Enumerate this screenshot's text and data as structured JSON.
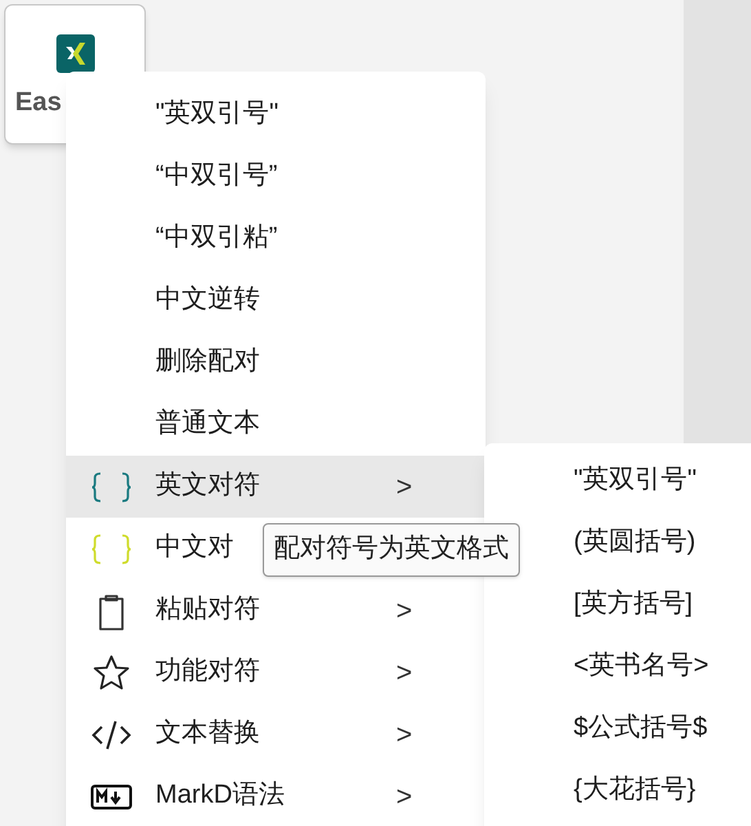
{
  "app_tile": {
    "label": "Eas"
  },
  "context_menu": {
    "items": [
      {
        "label": "\"英双引号\"",
        "kind": "plain",
        "selected": false
      },
      {
        "label": "“中双引号”",
        "kind": "plain",
        "selected": false
      },
      {
        "label": "“中双引粘”",
        "kind": "plain",
        "selected": false
      },
      {
        "label": "中文逆转",
        "kind": "plain",
        "selected": false
      },
      {
        "label": "删除配对",
        "kind": "plain",
        "selected": false
      },
      {
        "label": "普通文本",
        "kind": "plain",
        "selected": false
      },
      {
        "label": "英文对符",
        "kind": "submenu",
        "selected": true,
        "arrow": ">"
      },
      {
        "label": "中文对",
        "kind": "submenu",
        "selected": false
      },
      {
        "label": "粘贴对符",
        "kind": "submenu",
        "selected": false,
        "arrow": ">"
      },
      {
        "label": "功能对符",
        "kind": "submenu",
        "selected": false,
        "arrow": ">"
      },
      {
        "label": "文本替换",
        "kind": "submenu",
        "selected": false,
        "arrow": ">"
      },
      {
        "label": "MarkD语法",
        "kind": "submenu",
        "selected": false,
        "arrow": ">"
      }
    ]
  },
  "submenu": {
    "items": [
      {
        "label": "\"英双引号\""
      },
      {
        "label": "(英圆括号)"
      },
      {
        "label": "[英方括号]"
      },
      {
        "label": "<英书名号>"
      },
      {
        "label": "$公式括号$"
      },
      {
        "label": "{大花括号}"
      }
    ]
  },
  "tooltip": {
    "text": "配对符号为英文格式"
  }
}
